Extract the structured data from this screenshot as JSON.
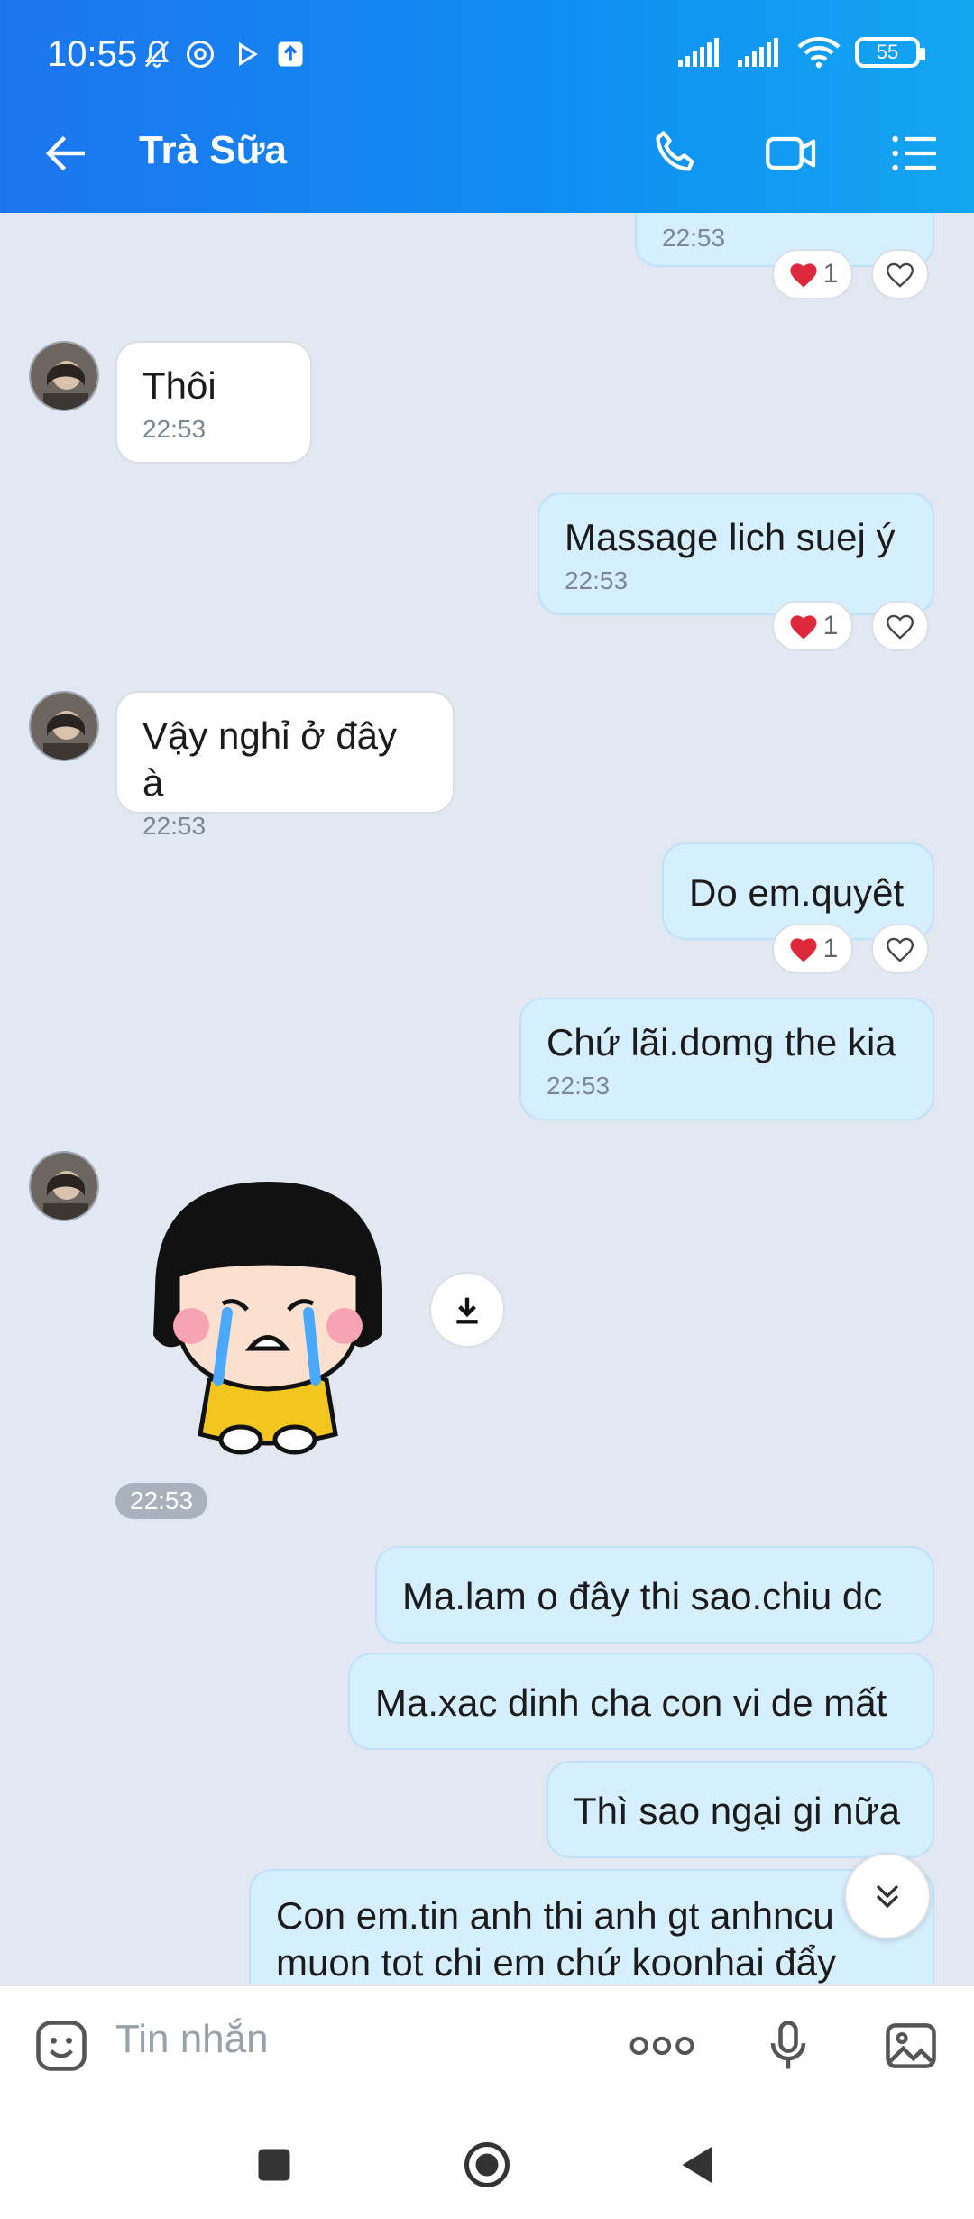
{
  "status_bar": {
    "time": "10:55",
    "battery": "55"
  },
  "header": {
    "title": "Trà Sữa"
  },
  "messages": [
    {
      "id": "m0",
      "ts": "22:53",
      "reaction_count": "1"
    },
    {
      "id": "m1",
      "text": "Thôi",
      "ts": "22:53"
    },
    {
      "id": "m2",
      "text": "Massage lich suej ý",
      "ts": "22:53",
      "reaction_count": "1"
    },
    {
      "id": "m3",
      "text": "Vậy nghỉ ở đây à",
      "ts": "22:53"
    },
    {
      "id": "m4",
      "text": "Do em.quyêt",
      "reaction_count": "1"
    },
    {
      "id": "m5",
      "text": "Chứ lãi.domg the kia",
      "ts": "22:53"
    },
    {
      "id": "m6",
      "sticker": "crying-girl-sticker",
      "ts": "22:53"
    },
    {
      "id": "m7",
      "text": "Ma.lam o đây thi sao.chiu dc"
    },
    {
      "id": "m8",
      "text": "Ma.xac dinh cha con vi de mất"
    },
    {
      "id": "m9",
      "text": "Thì sao ngại gi nữa"
    },
    {
      "id": "m10",
      "text_line1": "Con em.tin anh thi anh gt anhncu",
      "text_line2": "muon tot chi em chứ koonhai đẩy"
    }
  ],
  "input": {
    "placeholder": "Tin nhắn"
  },
  "icons": {
    "back": "arrow-left-icon",
    "call": "phone-icon",
    "video": "video-camera-icon",
    "menu": "list-menu-icon",
    "sticker": "sticker-face-icon",
    "more": "more-dots-icon",
    "mic": "microphone-icon",
    "gallery": "image-icon",
    "download": "download-icon",
    "scroll": "double-chevron-down-icon",
    "heart": "heart-icon"
  },
  "colors": {
    "header_start": "#1d75ee",
    "header_end": "#14a6f1",
    "outgoing_bubble": "#d6efff",
    "chat_bg": "#e2e8f1",
    "heart_red": "#e0283c"
  }
}
